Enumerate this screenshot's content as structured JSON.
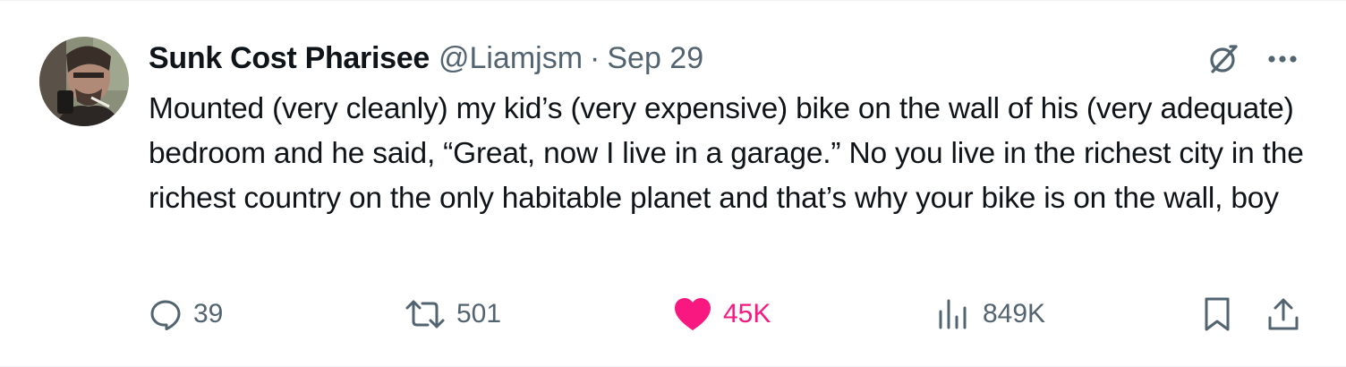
{
  "tweet": {
    "author_name": "Sunk Cost Pharisee",
    "handle": "@Liamjsm",
    "separator": "·",
    "date": "Sep 29",
    "text": "Mounted (very cleanly) my kid’s (very expensive) bike on the wall of his (very adequate) bedroom and he said, “Great, now I live in a garage.” No you live in the richest city in the richest country on the only habitable planet and that’s why your bike is on the wall, boy"
  },
  "actions": {
    "replies": "39",
    "reposts": "501",
    "likes": "45K",
    "views": "849K"
  },
  "icons": {
    "reply": "speech-bubble-icon",
    "repost": "repost-arrows-icon",
    "like": "heart-filled-icon",
    "views": "bar-chart-icon",
    "bookmark": "bookmark-icon",
    "share": "share-upload-icon",
    "grok": "grok-slash-icon",
    "more": "ellipsis-icon"
  },
  "colors": {
    "text": "#0f1419",
    "secondary": "#536471",
    "like": "#f91880"
  }
}
